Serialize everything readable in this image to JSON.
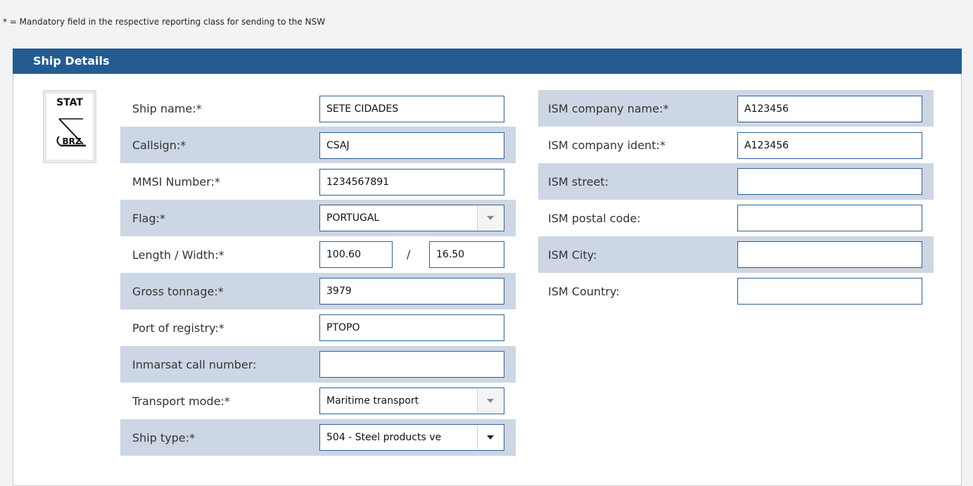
{
  "note": "* = Mandatory field in the respective reporting class for sending to the NSW",
  "panel": {
    "title": "Ship Details"
  },
  "logo": {
    "top_text": "STAT",
    "bottom_text": "BRZ"
  },
  "left": {
    "ship_name": {
      "label": "Ship name:*",
      "value": "SETE CIDADES"
    },
    "callsign": {
      "label": "Callsign:*",
      "value": "CSAJ"
    },
    "mmsi": {
      "label": "MMSI Number:*",
      "value": "1234567891"
    },
    "flag": {
      "label": "Flag:*",
      "value": "PORTUGAL"
    },
    "length_width": {
      "label": "Length / Width:*",
      "length": "100.60",
      "separator": "/",
      "width": "16.50"
    },
    "gross_tonnage": {
      "label": "Gross tonnage:*",
      "value": "3979"
    },
    "port_registry": {
      "label": "Port of registry:*",
      "value": "PTOPO"
    },
    "inmarsat": {
      "label": "Inmarsat call number:",
      "value": ""
    },
    "transport_mode": {
      "label": "Transport mode:*",
      "value": "Maritime transport"
    },
    "ship_type": {
      "label": "Ship type:*",
      "value": "504 - Steel products ve"
    }
  },
  "right": {
    "ism_company_name": {
      "label": "ISM company name:*",
      "value": "A123456"
    },
    "ism_company_ident": {
      "label": "ISM company ident:*",
      "value": "A123456"
    },
    "ism_street": {
      "label": "ISM street:",
      "value": ""
    },
    "ism_postal_code": {
      "label": "ISM postal code:",
      "value": ""
    },
    "ism_city": {
      "label": "ISM City:",
      "value": ""
    },
    "ism_country": {
      "label": "ISM Country:",
      "value": ""
    }
  }
}
